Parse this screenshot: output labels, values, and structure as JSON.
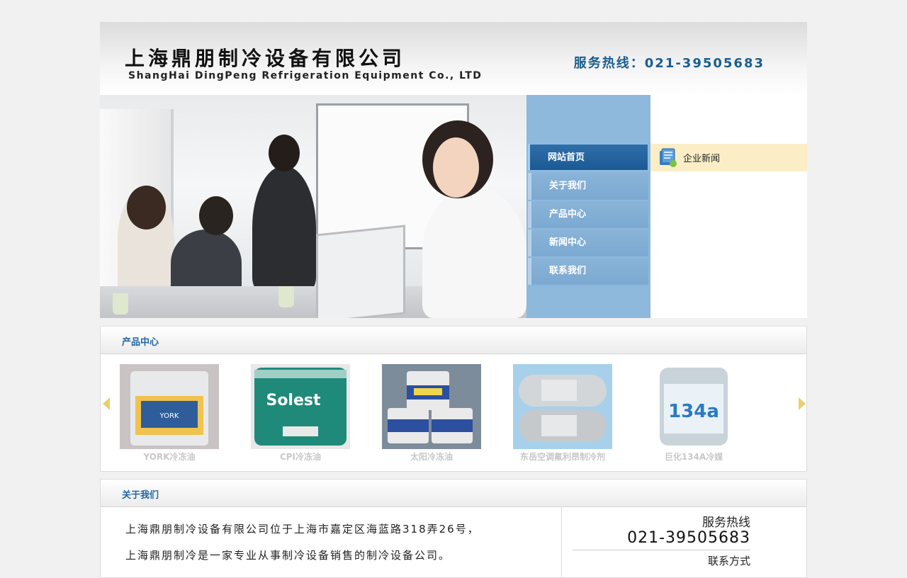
{
  "header": {
    "company_cn": "上海鼎朋制冷设备有限公司",
    "company_en": "ShangHai DingPeng Refrigeration Equipment Co., LTD",
    "hotline": "服务热线：021-39505683"
  },
  "nav": {
    "items": [
      {
        "label": "网站首页",
        "active": true
      },
      {
        "label": "关于我们"
      },
      {
        "label": "产品中心"
      },
      {
        "label": "新闻中心"
      },
      {
        "label": "联系我们"
      }
    ]
  },
  "news": {
    "label": "企业新闻"
  },
  "products": {
    "title": "产品中心",
    "items": [
      {
        "label": "YORK冷冻油",
        "colors": [
          "#dfe1e2",
          "#e8c25a"
        ]
      },
      {
        "label": "CPI冷冻油",
        "colors": [
          "#1f8a7a",
          "#e9e9e9"
        ]
      },
      {
        "label": "太阳冷冻油",
        "colors": [
          "#7d8c9b",
          "#f0d64a"
        ]
      },
      {
        "label": "东岳空调氟利昂制冷剂",
        "colors": [
          "#a7d0ea",
          "#cfd3d6"
        ]
      },
      {
        "label": "巨化134A冷媒",
        "colors": [
          "#ffffff",
          "#2b7ac2"
        ]
      }
    ]
  },
  "about": {
    "title": "关于我们",
    "line1": "上海鼎朋制冷设备有限公司位于上海市嘉定区海蓝路318弄26号，",
    "line2": "上海鼎朋制冷是一家专业从事制冷设备销售的制冷设备公司。",
    "side_hotline_label": "服务热线",
    "side_phone": "021-39505683",
    "side_contact": "联系方式"
  }
}
